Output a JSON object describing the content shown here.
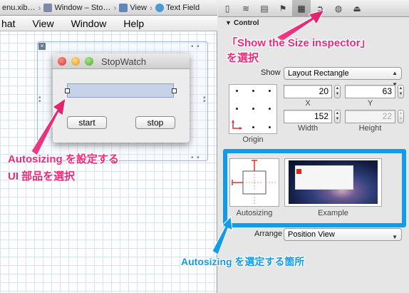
{
  "jumpbar": {
    "items": [
      "enu.xib…",
      "Window – Sto…",
      "View",
      "Text Field"
    ]
  },
  "menubar": {
    "items": [
      "hat",
      "View",
      "Window",
      "Help"
    ]
  },
  "window": {
    "title": "StopWatch",
    "buttons": [
      "start",
      "stop"
    ]
  },
  "inspector": {
    "toolbar_icons": [
      "file-icon",
      "quick-help-icon",
      "identity-icon",
      "attributes-icon",
      "size-ruler-icon",
      "connections-icon",
      "bindings-icon",
      "effects-icon"
    ],
    "section_title": "Control",
    "show_label": "Show",
    "show_value": "Layout Rectangle",
    "x_value": "20",
    "y_value": "63",
    "x_label": "X",
    "y_label": "Y",
    "width_value": "152",
    "height_value": "22",
    "width_label": "Width",
    "height_label": "Height",
    "origin_label": "Origin",
    "autosizing_label": "Autosizing",
    "example_label": "Example",
    "arrange_label": "Arrange",
    "arrange_value": "Position View"
  },
  "annotations": {
    "size_inspector_line1": "「Show the Size inspector」",
    "size_inspector_line2": "を選択",
    "autosizing_ui_line1": "Autosizing を設定する",
    "autosizing_ui_line2": "UI 部品を選択",
    "autosizing_place": "Autosizing を選定する箇所"
  },
  "colors": {
    "annotation_pink": "#ec2a78",
    "highlight_blue": "#129be6",
    "text_field_fill": "#c6d1ea"
  }
}
